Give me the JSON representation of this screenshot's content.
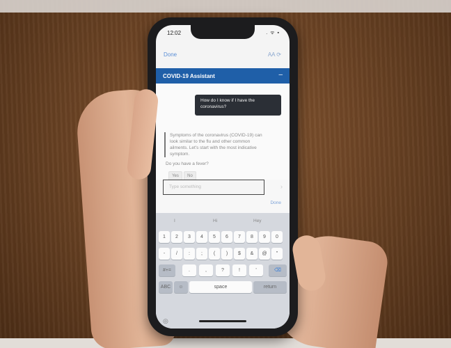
{
  "status_bar": {
    "time": "12:02",
    "icons": ". ᯤ ▪"
  },
  "nav": {
    "done": "Done",
    "right": "AA ⟳"
  },
  "assistant": {
    "title": "COVID-19 Assistant",
    "minimize": "–"
  },
  "chat": {
    "user_message": "How do I know if I have the coronavirus?",
    "bot_message": "Symptoms of the coronavirus (COVID-19) can look similar to the flu and other common ailments. Let's start with the most indicative symptom.",
    "bot_question": "Do you have a fever?",
    "replies": [
      "Yes",
      "No"
    ]
  },
  "input": {
    "placeholder": "Type something",
    "send_icon": "send-icon"
  },
  "keyboard": {
    "done_label": "Done",
    "suggestions": [
      "I",
      "Hi",
      "Hey"
    ],
    "row1": [
      "1",
      "2",
      "3",
      "4",
      "5",
      "6",
      "7",
      "8",
      "9",
      "0"
    ],
    "row2": [
      "-",
      "/",
      ":",
      ";",
      "(",
      ")",
      "$",
      "&",
      "@",
      "\""
    ],
    "row3": [
      "#+=",
      ".",
      ",",
      "?",
      "!",
      "'",
      "⌫"
    ],
    "row4": [
      "ABC",
      "☺",
      "space",
      "return"
    ]
  }
}
